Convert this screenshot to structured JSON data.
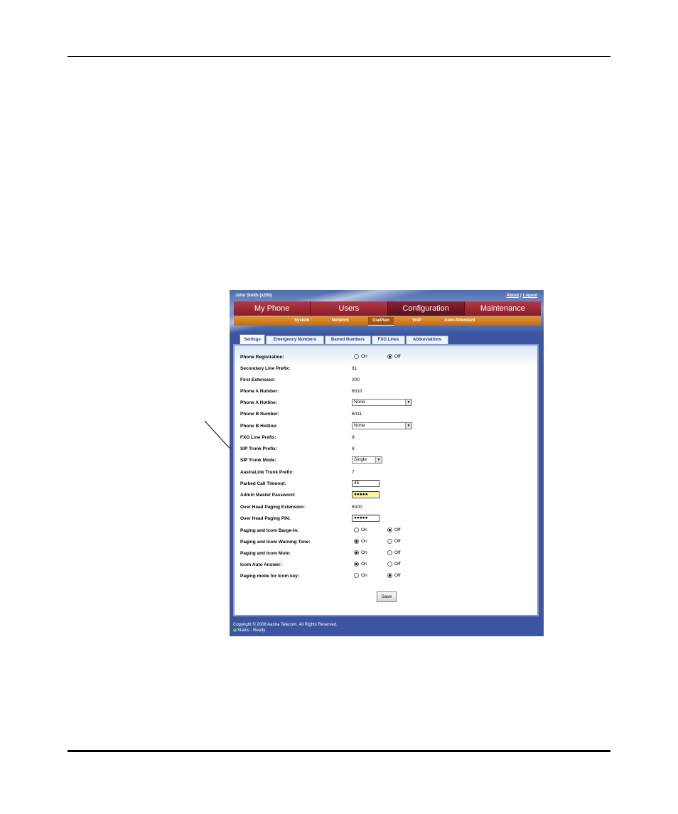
{
  "header": {
    "user": "John Smith (x200)",
    "about": "About",
    "separator": "|",
    "logout": "Logout"
  },
  "main_nav": [
    {
      "label": "My Phone",
      "active": false
    },
    {
      "label": "Users",
      "active": false
    },
    {
      "label": "Configuration",
      "active": true
    },
    {
      "label": "Maintenance",
      "active": false
    }
  ],
  "sub_nav": [
    {
      "label": "System",
      "active": false
    },
    {
      "label": "Network",
      "active": false
    },
    {
      "label": "DialPlan",
      "active": true
    },
    {
      "label": "VoIP",
      "active": false
    },
    {
      "label": "Auto-Attendant",
      "active": false
    }
  ],
  "tabs": [
    {
      "label": "Settings",
      "active": true
    },
    {
      "label": "Emergency Numbers",
      "active": false
    },
    {
      "label": "Barred Numbers",
      "active": false
    },
    {
      "label": "FXO Lines",
      "active": false
    },
    {
      "label": "Abbreviations",
      "active": false
    }
  ],
  "radio_labels": {
    "on": "On",
    "off": "Off"
  },
  "form": {
    "phone_registration": {
      "label": "Phone Registration:",
      "value": "Off"
    },
    "secondary_line_prefix": {
      "label": "Secondary Line Prefix:",
      "value": "61"
    },
    "first_extension": {
      "label": "First Extension:",
      "value": "200"
    },
    "phone_a_number": {
      "label": "Phone A Number:",
      "value": "6010"
    },
    "phone_a_hotline": {
      "label": "Phone A Hotline:",
      "value": "None"
    },
    "phone_b_number": {
      "label": "Phone B Number:",
      "value": "6011"
    },
    "phone_b_hotline": {
      "label": "Phone B Hotline:",
      "value": "None"
    },
    "fxo_line_prefix": {
      "label": "FXO Line Prefix:",
      "value": "9"
    },
    "sip_trunk_prefix": {
      "label": "SIP Trunk Prefix:",
      "value": "8"
    },
    "sip_trunk_mode": {
      "label": "SIP Trunk Mode:",
      "value": "Single"
    },
    "aastralink_trunk_prefix": {
      "label": "AastraLink Trunk Prefix:",
      "value": "7"
    },
    "parked_call_timeout": {
      "label": "Parked Call Timeout:",
      "value": "45"
    },
    "admin_master_password": {
      "label": "Admin Master Password:",
      "value": "●●●●●"
    },
    "over_head_paging_extension": {
      "label": "Over Head Paging Extension:",
      "value": "6000"
    },
    "over_head_paging_pin": {
      "label": "Over Head Paging PIN:",
      "value": "●●●●●"
    },
    "paging_icom_barge_in": {
      "label": "Paging and Icom Barge-In:",
      "value": "Off"
    },
    "paging_icom_warning_tone": {
      "label": "Paging and Icom Warning Tone:",
      "value": "On"
    },
    "paging_icom_mute": {
      "label": "Paging and Icom Mute:",
      "value": "On"
    },
    "icom_auto_answer": {
      "label": "Icom Auto Answer:",
      "value": "On"
    },
    "paging_mode_icom_key": {
      "label": "Paging mode for Icom key:",
      "value": "Off"
    }
  },
  "save_label": "Save",
  "footer": {
    "copyright": "Copyright © 2008 Aastra Telecom. All Rights Reserved.",
    "status": "Status : Ready"
  },
  "colors": {
    "frame": "#3d55a0",
    "main_nav": "#8b1a28",
    "sub_nav": "#d07a1c",
    "status_ok": "#4cd13c",
    "password_highlight": "#fbf69b"
  }
}
